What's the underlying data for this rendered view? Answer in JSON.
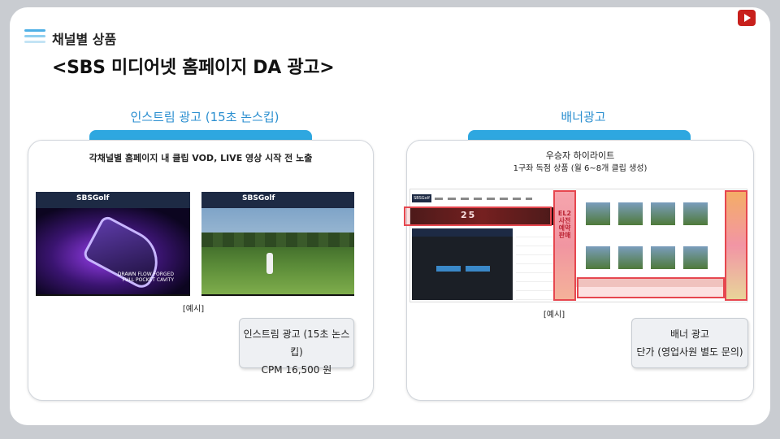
{
  "header": {
    "section_label": "채널별 상품",
    "title": "<SBS 미디어넷 홈페이지 DA 광고>"
  },
  "left": {
    "section_title": "인스트림 광고 (15초 논스킵)",
    "description": "각채널별 홈페이지 내 클립 VOD, LIVE 영상 시작 전 노출",
    "logo_text": "SBSGolf",
    "video1_overlay": "DRAWN FLOW FORGED\nFULL POCKET CAVITY",
    "example_label": "[예시]",
    "price_line1": "인스트림 광고 (15초 논스킵)",
    "price_line2": "CPM 16,500 원"
  },
  "right": {
    "section_title": "배너광고",
    "description_line1": "우승자 하이라이트",
    "description_line2": "1구좌 독점 상품 (월 6~8개 클립 생성)",
    "logo_text": "SBSGolf",
    "hero_text": "25",
    "side_ad_text": "EL2\n사전\n예약\n판매",
    "example_label": "[예시]",
    "price_line1": "배너 광고",
    "price_line2": "단가 (영업사원 별도 문의)"
  },
  "colors": {
    "accent": "#2ea7e0",
    "highlight": "#e6474f"
  }
}
